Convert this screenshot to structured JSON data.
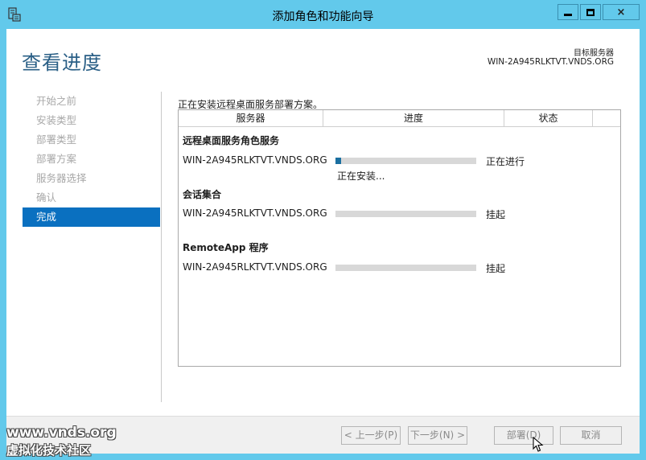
{
  "window": {
    "title": "添加角色和功能向导",
    "controls": {
      "minimize": "minimize-icon",
      "maximize": "maximize-icon",
      "close": "×"
    }
  },
  "header": {
    "page_title": "查看进度",
    "target_label": "目标服务器",
    "target_value": "WIN-2A945RLKTVT.VNDS.ORG"
  },
  "nav": {
    "items": [
      {
        "label": "开始之前",
        "active": false
      },
      {
        "label": "安装类型",
        "active": false
      },
      {
        "label": "部署类型",
        "active": false
      },
      {
        "label": "部署方案",
        "active": false
      },
      {
        "label": "服务器选择",
        "active": false
      },
      {
        "label": "确认",
        "active": false
      },
      {
        "label": "完成",
        "active": true
      }
    ]
  },
  "main": {
    "status_line": "正在安装远程桌面服务部署方案。",
    "columns": [
      "服务器",
      "进度",
      "状态"
    ],
    "groups": [
      {
        "name": "远程桌面服务角色服务",
        "server": "WIN-2A945RLKTVT.VNDS.ORG",
        "progress": 0.04,
        "status": "正在进行",
        "detail": "正在安装..."
      },
      {
        "name": "会话集合",
        "server": "WIN-2A945RLKTVT.VNDS.ORG",
        "progress": 0,
        "status": "挂起"
      },
      {
        "name": "RemoteApp 程序",
        "server": "WIN-2A945RLKTVT.VNDS.ORG",
        "progress": 0,
        "status": "挂起"
      }
    ]
  },
  "footer": {
    "prev": "< 上一步(P)",
    "next": "下一步(N) >",
    "deploy": "部署(D)",
    "cancel": "取消"
  },
  "watermark": {
    "line1": "www.vnds.org",
    "line2": "虚拟化技术社区"
  },
  "colors": {
    "frame": "#62c9eb",
    "accent": "#0a70c0",
    "title": "#2a5f86",
    "progress_fill": "#1a6fa0"
  }
}
